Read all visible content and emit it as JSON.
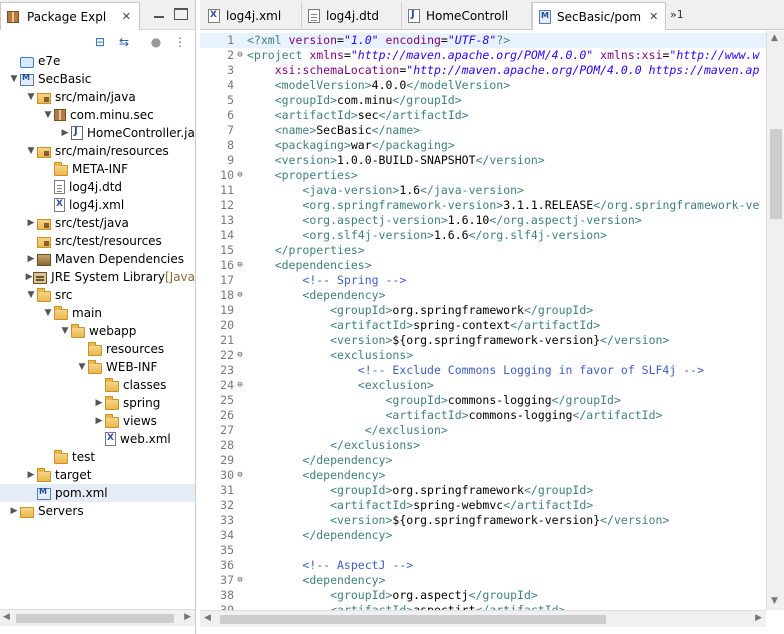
{
  "explorer": {
    "title": "Package Expl",
    "close": "✕",
    "toolbar": [
      "collapse-all-icon",
      "link-with-editor-icon",
      "filter-icon",
      "view-menu-icon"
    ],
    "items": [
      {
        "label": "e7e",
        "indent": 0,
        "arrow": "",
        "icon": "cloud"
      },
      {
        "label": "SecBasic",
        "indent": 0,
        "arrow": "▼",
        "icon": "project"
      },
      {
        "label": "src/main/java",
        "indent": 1,
        "arrow": "▼",
        "icon": "srcfolder"
      },
      {
        "label": "com.minu.sec",
        "indent": 2,
        "arrow": "▼",
        "icon": "pkg"
      },
      {
        "label": "HomeController.ja",
        "indent": 3,
        "arrow": "▶",
        "icon": "java"
      },
      {
        "label": "src/main/resources",
        "indent": 1,
        "arrow": "▼",
        "icon": "srcfolder"
      },
      {
        "label": "META-INF",
        "indent": 2,
        "arrow": "",
        "icon": "folder"
      },
      {
        "label": "log4j.dtd",
        "indent": 2,
        "arrow": "",
        "icon": "file"
      },
      {
        "label": "log4j.xml",
        "indent": 2,
        "arrow": "",
        "icon": "xml"
      },
      {
        "label": "src/test/java",
        "indent": 1,
        "arrow": "▶",
        "icon": "srcfolder"
      },
      {
        "label": "src/test/resources",
        "indent": 1,
        "arrow": "",
        "icon": "srcfolder"
      },
      {
        "label": "Maven Dependencies",
        "indent": 1,
        "arrow": "▶",
        "icon": "lib"
      },
      {
        "label": "JRE System Library",
        "indent": 1,
        "arrow": "▶",
        "icon": "jre",
        "suffix": " [Java"
      },
      {
        "label": "src",
        "indent": 1,
        "arrow": "▼",
        "icon": "folder"
      },
      {
        "label": "main",
        "indent": 2,
        "arrow": "▼",
        "icon": "folder"
      },
      {
        "label": "webapp",
        "indent": 3,
        "arrow": "▼",
        "icon": "folder"
      },
      {
        "label": "resources",
        "indent": 4,
        "arrow": "",
        "icon": "folder"
      },
      {
        "label": "WEB-INF",
        "indent": 4,
        "arrow": "▼",
        "icon": "folder"
      },
      {
        "label": "classes",
        "indent": 5,
        "arrow": "",
        "icon": "folder"
      },
      {
        "label": "spring",
        "indent": 5,
        "arrow": "▶",
        "icon": "folder"
      },
      {
        "label": "views",
        "indent": 5,
        "arrow": "▶",
        "icon": "folder"
      },
      {
        "label": "web.xml",
        "indent": 5,
        "arrow": "",
        "icon": "xml"
      },
      {
        "label": "test",
        "indent": 2,
        "arrow": "",
        "icon": "folder"
      },
      {
        "label": "target",
        "indent": 1,
        "arrow": "▶",
        "icon": "folder"
      },
      {
        "label": "pom.xml",
        "indent": 1,
        "arrow": "",
        "icon": "pom",
        "selected": true
      },
      {
        "label": "Servers",
        "indent": 0,
        "arrow": "▶",
        "icon": "servers"
      }
    ]
  },
  "editor": {
    "tabs": [
      {
        "label": "log4j.xml",
        "icon": "x"
      },
      {
        "label": "log4j.dtd",
        "icon": "d"
      },
      {
        "label": "HomeControll",
        "icon": "j"
      },
      {
        "label": "SecBasic/pom",
        "icon": "m",
        "active": true
      }
    ],
    "overflow": "»1",
    "lines": [
      {
        "n": "1",
        "f": "",
        "t": [
          [
            "t",
            "<?"
          ],
          [
            "t",
            "xml "
          ],
          [
            "a",
            "version"
          ],
          [
            "txt",
            "="
          ],
          [
            "v",
            "\"1.0\""
          ],
          [
            "txt",
            " "
          ],
          [
            "a",
            "encoding"
          ],
          [
            "txt",
            "="
          ],
          [
            "v",
            "\"UTF-8\""
          ],
          [
            "t",
            "?>"
          ]
        ],
        "cur": true
      },
      {
        "n": "2",
        "f": "⊖",
        "t": [
          [
            "t",
            "<project "
          ],
          [
            "a",
            "xmlns"
          ],
          [
            "txt",
            "="
          ],
          [
            "v",
            "\"http://maven.apache.org/POM/4.0.0\""
          ],
          [
            "txt",
            " "
          ],
          [
            "a",
            "xmlns:xsi"
          ],
          [
            "txt",
            "="
          ],
          [
            "v",
            "\"http://www.w"
          ]
        ]
      },
      {
        "n": "3",
        "f": "",
        "t": [
          [
            "txt",
            "    "
          ],
          [
            "a",
            "xsi:schemaLocation"
          ],
          [
            "txt",
            "="
          ],
          [
            "v",
            "\"http://maven.apache.org/POM/4.0.0 https://maven.ap"
          ]
        ]
      },
      {
        "n": "4",
        "f": "",
        "t": [
          [
            "txt",
            "    "
          ],
          [
            "t",
            "<modelVersion>"
          ],
          [
            "txt",
            "4.0.0"
          ],
          [
            "t",
            "</modelVersion>"
          ]
        ]
      },
      {
        "n": "5",
        "f": "",
        "t": [
          [
            "txt",
            "    "
          ],
          [
            "t",
            "<groupId>"
          ],
          [
            "txt",
            "com.minu"
          ],
          [
            "t",
            "</groupId>"
          ]
        ]
      },
      {
        "n": "6",
        "f": "",
        "t": [
          [
            "txt",
            "    "
          ],
          [
            "t",
            "<artifactId>"
          ],
          [
            "txt",
            "sec"
          ],
          [
            "t",
            "</artifactId>"
          ]
        ]
      },
      {
        "n": "7",
        "f": "",
        "t": [
          [
            "txt",
            "    "
          ],
          [
            "t",
            "<name>"
          ],
          [
            "txt",
            "SecBasic"
          ],
          [
            "t",
            "</name>"
          ]
        ]
      },
      {
        "n": "8",
        "f": "",
        "t": [
          [
            "txt",
            "    "
          ],
          [
            "t",
            "<packaging>"
          ],
          [
            "txt",
            "war"
          ],
          [
            "t",
            "</packaging>"
          ]
        ]
      },
      {
        "n": "9",
        "f": "",
        "t": [
          [
            "txt",
            "    "
          ],
          [
            "t",
            "<version>"
          ],
          [
            "txt",
            "1.0.0-BUILD-SNAPSHOT"
          ],
          [
            "t",
            "</version>"
          ]
        ]
      },
      {
        "n": "10",
        "f": "⊖",
        "t": [
          [
            "txt",
            "    "
          ],
          [
            "t",
            "<properties>"
          ]
        ]
      },
      {
        "n": "11",
        "f": "",
        "t": [
          [
            "txt",
            "        "
          ],
          [
            "t",
            "<java-version>"
          ],
          [
            "txt",
            "1.6"
          ],
          [
            "t",
            "</java-version>"
          ]
        ]
      },
      {
        "n": "12",
        "f": "",
        "t": [
          [
            "txt",
            "        "
          ],
          [
            "t",
            "<org.springframework-version>"
          ],
          [
            "txt",
            "3.1.1.RELEASE"
          ],
          [
            "t",
            "</org.springframework-ve"
          ]
        ]
      },
      {
        "n": "13",
        "f": "",
        "t": [
          [
            "txt",
            "        "
          ],
          [
            "t",
            "<org.aspectj-version>"
          ],
          [
            "txt",
            "1.6.10"
          ],
          [
            "t",
            "</org.aspectj-version>"
          ]
        ]
      },
      {
        "n": "14",
        "f": "",
        "t": [
          [
            "txt",
            "        "
          ],
          [
            "t",
            "<org.slf4j-version>"
          ],
          [
            "txt",
            "1.6.6"
          ],
          [
            "t",
            "</org.slf4j-version>"
          ]
        ]
      },
      {
        "n": "15",
        "f": "",
        "t": [
          [
            "txt",
            "    "
          ],
          [
            "t",
            "</properties>"
          ]
        ]
      },
      {
        "n": "16",
        "f": "⊖",
        "t": [
          [
            "txt",
            "    "
          ],
          [
            "t",
            "<dependencies>"
          ]
        ]
      },
      {
        "n": "17",
        "f": "",
        "t": [
          [
            "txt",
            "        "
          ],
          [
            "c",
            "<!-- Spring -->"
          ]
        ]
      },
      {
        "n": "18",
        "f": "⊖",
        "t": [
          [
            "txt",
            "        "
          ],
          [
            "t",
            "<dependency>"
          ]
        ]
      },
      {
        "n": "19",
        "f": "",
        "t": [
          [
            "txt",
            "            "
          ],
          [
            "t",
            "<groupId>"
          ],
          [
            "txt",
            "org.springframework"
          ],
          [
            "t",
            "</groupId>"
          ]
        ]
      },
      {
        "n": "20",
        "f": "",
        "t": [
          [
            "txt",
            "            "
          ],
          [
            "t",
            "<artifactId>"
          ],
          [
            "txt",
            "spring-context"
          ],
          [
            "t",
            "</artifactId>"
          ]
        ]
      },
      {
        "n": "21",
        "f": "",
        "t": [
          [
            "txt",
            "            "
          ],
          [
            "t",
            "<version>"
          ],
          [
            "txt",
            "${org.springframework-version}"
          ],
          [
            "t",
            "</version>"
          ]
        ]
      },
      {
        "n": "22",
        "f": "⊖",
        "t": [
          [
            "txt",
            "            "
          ],
          [
            "t",
            "<exclusions>"
          ]
        ]
      },
      {
        "n": "23",
        "f": "",
        "t": [
          [
            "txt",
            "                "
          ],
          [
            "c",
            "<!-- Exclude Commons Logging in favor of SLF4j -->"
          ]
        ]
      },
      {
        "n": "24",
        "f": "⊖",
        "t": [
          [
            "txt",
            "                "
          ],
          [
            "t",
            "<exclusion>"
          ]
        ]
      },
      {
        "n": "25",
        "f": "",
        "t": [
          [
            "txt",
            "                    "
          ],
          [
            "t",
            "<groupId>"
          ],
          [
            "txt",
            "commons-logging"
          ],
          [
            "t",
            "</groupId>"
          ]
        ]
      },
      {
        "n": "26",
        "f": "",
        "t": [
          [
            "txt",
            "                    "
          ],
          [
            "t",
            "<artifactId>"
          ],
          [
            "txt",
            "commons-logging"
          ],
          [
            "t",
            "</artifactId>"
          ]
        ]
      },
      {
        "n": "27",
        "f": "",
        "t": [
          [
            "txt",
            "                 "
          ],
          [
            "t",
            "</exclusion>"
          ]
        ]
      },
      {
        "n": "28",
        "f": "",
        "t": [
          [
            "txt",
            "            "
          ],
          [
            "t",
            "</exclusions>"
          ]
        ]
      },
      {
        "n": "29",
        "f": "",
        "t": [
          [
            "txt",
            "        "
          ],
          [
            "t",
            "</dependency>"
          ]
        ]
      },
      {
        "n": "30",
        "f": "⊖",
        "t": [
          [
            "txt",
            "        "
          ],
          [
            "t",
            "<dependency>"
          ]
        ]
      },
      {
        "n": "31",
        "f": "",
        "t": [
          [
            "txt",
            "            "
          ],
          [
            "t",
            "<groupId>"
          ],
          [
            "txt",
            "org.springframework"
          ],
          [
            "t",
            "</groupId>"
          ]
        ]
      },
      {
        "n": "32",
        "f": "",
        "t": [
          [
            "txt",
            "            "
          ],
          [
            "t",
            "<artifactId>"
          ],
          [
            "txt",
            "spring-webmvc"
          ],
          [
            "t",
            "</artifactId>"
          ]
        ]
      },
      {
        "n": "33",
        "f": "",
        "t": [
          [
            "txt",
            "            "
          ],
          [
            "t",
            "<version>"
          ],
          [
            "txt",
            "${org.springframework-version}"
          ],
          [
            "t",
            "</version>"
          ]
        ]
      },
      {
        "n": "34",
        "f": "",
        "t": [
          [
            "txt",
            "        "
          ],
          [
            "t",
            "</dependency>"
          ]
        ]
      },
      {
        "n": "35",
        "f": "",
        "t": []
      },
      {
        "n": "36",
        "f": "",
        "t": [
          [
            "txt",
            "        "
          ],
          [
            "c",
            "<!-- AspectJ -->"
          ]
        ]
      },
      {
        "n": "37",
        "f": "⊖",
        "t": [
          [
            "txt",
            "        "
          ],
          [
            "t",
            "<dependency>"
          ]
        ]
      },
      {
        "n": "38",
        "f": "",
        "t": [
          [
            "txt",
            "            "
          ],
          [
            "t",
            "<groupId>"
          ],
          [
            "txt",
            "org.aspectj"
          ],
          [
            "t",
            "</groupId>"
          ]
        ]
      },
      {
        "n": "39",
        "f": "",
        "t": [
          [
            "txt",
            "            "
          ],
          [
            "t",
            "<artifactId>"
          ],
          [
            "txt",
            "aspectjrt"
          ],
          [
            "t",
            "</artifactId>"
          ]
        ]
      }
    ]
  }
}
